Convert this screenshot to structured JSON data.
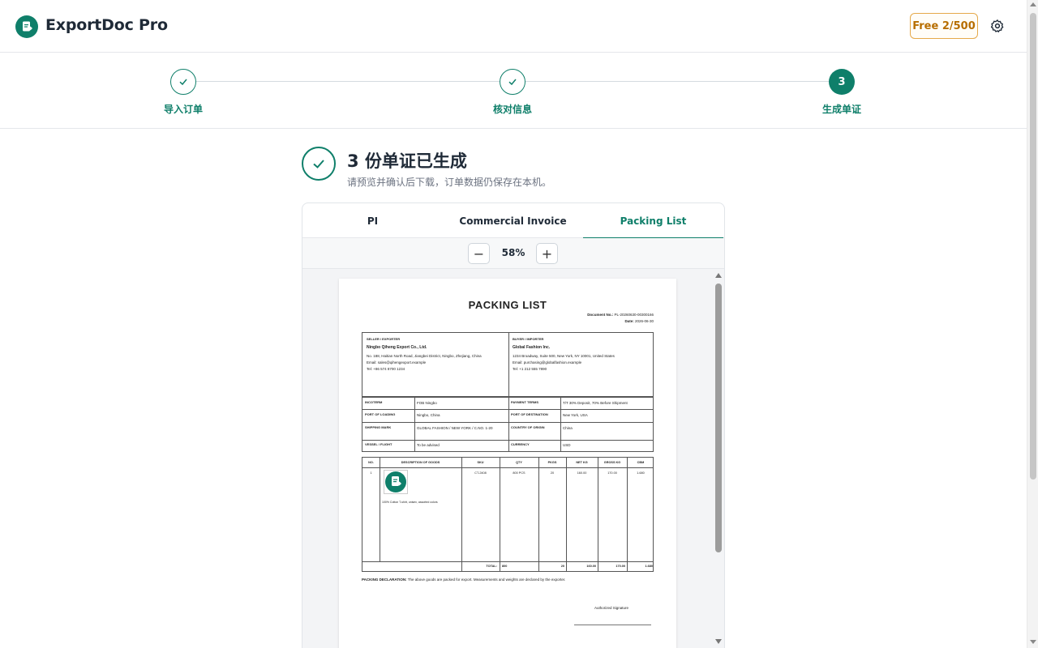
{
  "app": {
    "name": "ExportDoc Pro",
    "plan_badge": "Free 2/500"
  },
  "stepper": {
    "steps": [
      {
        "label": "导入订单",
        "state": "done"
      },
      {
        "label": "核对信息",
        "state": "done"
      },
      {
        "label": "生成单证",
        "state": "current",
        "number": "3"
      }
    ]
  },
  "result": {
    "title": "3 份单证已生成",
    "subtitle": "请预览并确认后下载，订单数据仍保存在本机。"
  },
  "preview": {
    "tabs": [
      {
        "label": "PI"
      },
      {
        "label": "Commercial Invoice"
      },
      {
        "label": "Packing List",
        "active": true
      }
    ],
    "zoom": "58%",
    "zoom_out": "−",
    "zoom_in": "+"
  },
  "document": {
    "title": "PACKING LIST",
    "doc_no_label": "Document No.:",
    "doc_no": "PL-20260630-00300166",
    "date_label": "Date:",
    "date": "2026-06-30",
    "seller": {
      "label": "SELLER / EXPORTER",
      "name": "Ningbo Qiheng Export Co., Ltd.",
      "address": "No. 188, Haitian North Road, Jiangbei District, Ningbo, Zhejiang, China",
      "email": "Email: sales@qihengexport.example",
      "tel": "Tel: +86 574 8700 1234"
    },
    "buyer": {
      "label": "BUYER / IMPORTER",
      "name": "Global Fashion Inc.",
      "address": "1234 Broadway, Suite 500, New York, NY 10001, United States",
      "email": "Email: purchasing@globalfashion.example",
      "tel": "Tel: +1 212 555 7890"
    },
    "terms": [
      {
        "l1": "INCOTERM",
        "v1": "FOB Ningbo",
        "l2": "PAYMENT TERMS",
        "v2": "T/T 30% Deposit, 70% Before Shipment"
      },
      {
        "l1": "PORT OF LOADING",
        "v1": "Ningbo, China",
        "l2": "PORT OF DESTINATION",
        "v2": "New York, USA"
      },
      {
        "l1": "SHIPPING MARK",
        "v1": "GLOBAL FASHION / NEW YORK / C.NO. 1-20",
        "l2": "COUNTRY OF ORIGIN",
        "v2": "China"
      },
      {
        "l1": "VESSEL / FLIGHT",
        "v1": "To be advised",
        "l2": "CURRENCY",
        "v2": "USD"
      }
    ],
    "table_headers": [
      "NO.",
      "DESCRIPTION OF GOODS",
      "SKU",
      "QTY",
      "PKGS",
      "NET KG",
      "GROSS KG",
      "CBM"
    ],
    "rows": [
      {
        "no": "1",
        "desc": "100% Cotton T-shirt, unisex, assorted colors",
        "sku": "CT-2408",
        "qty": "800 PCS",
        "pkgs": "20",
        "net": "160.00",
        "gross": "170.00",
        "cbm": "1.680"
      }
    ],
    "totals": {
      "label": "TOTAL:",
      "qty": "800",
      "pkgs": "20",
      "net": "160.00",
      "gross": "170.00",
      "cbm": "1.680"
    },
    "declaration_label": "PACKING DECLARATION:",
    "declaration": "The above goods are packed for export. Measurements and weights are declared by the exporter.",
    "signature": "Authorized Signature"
  },
  "colors": {
    "accent": "#0f7f6a",
    "badge": "#b76e00"
  }
}
